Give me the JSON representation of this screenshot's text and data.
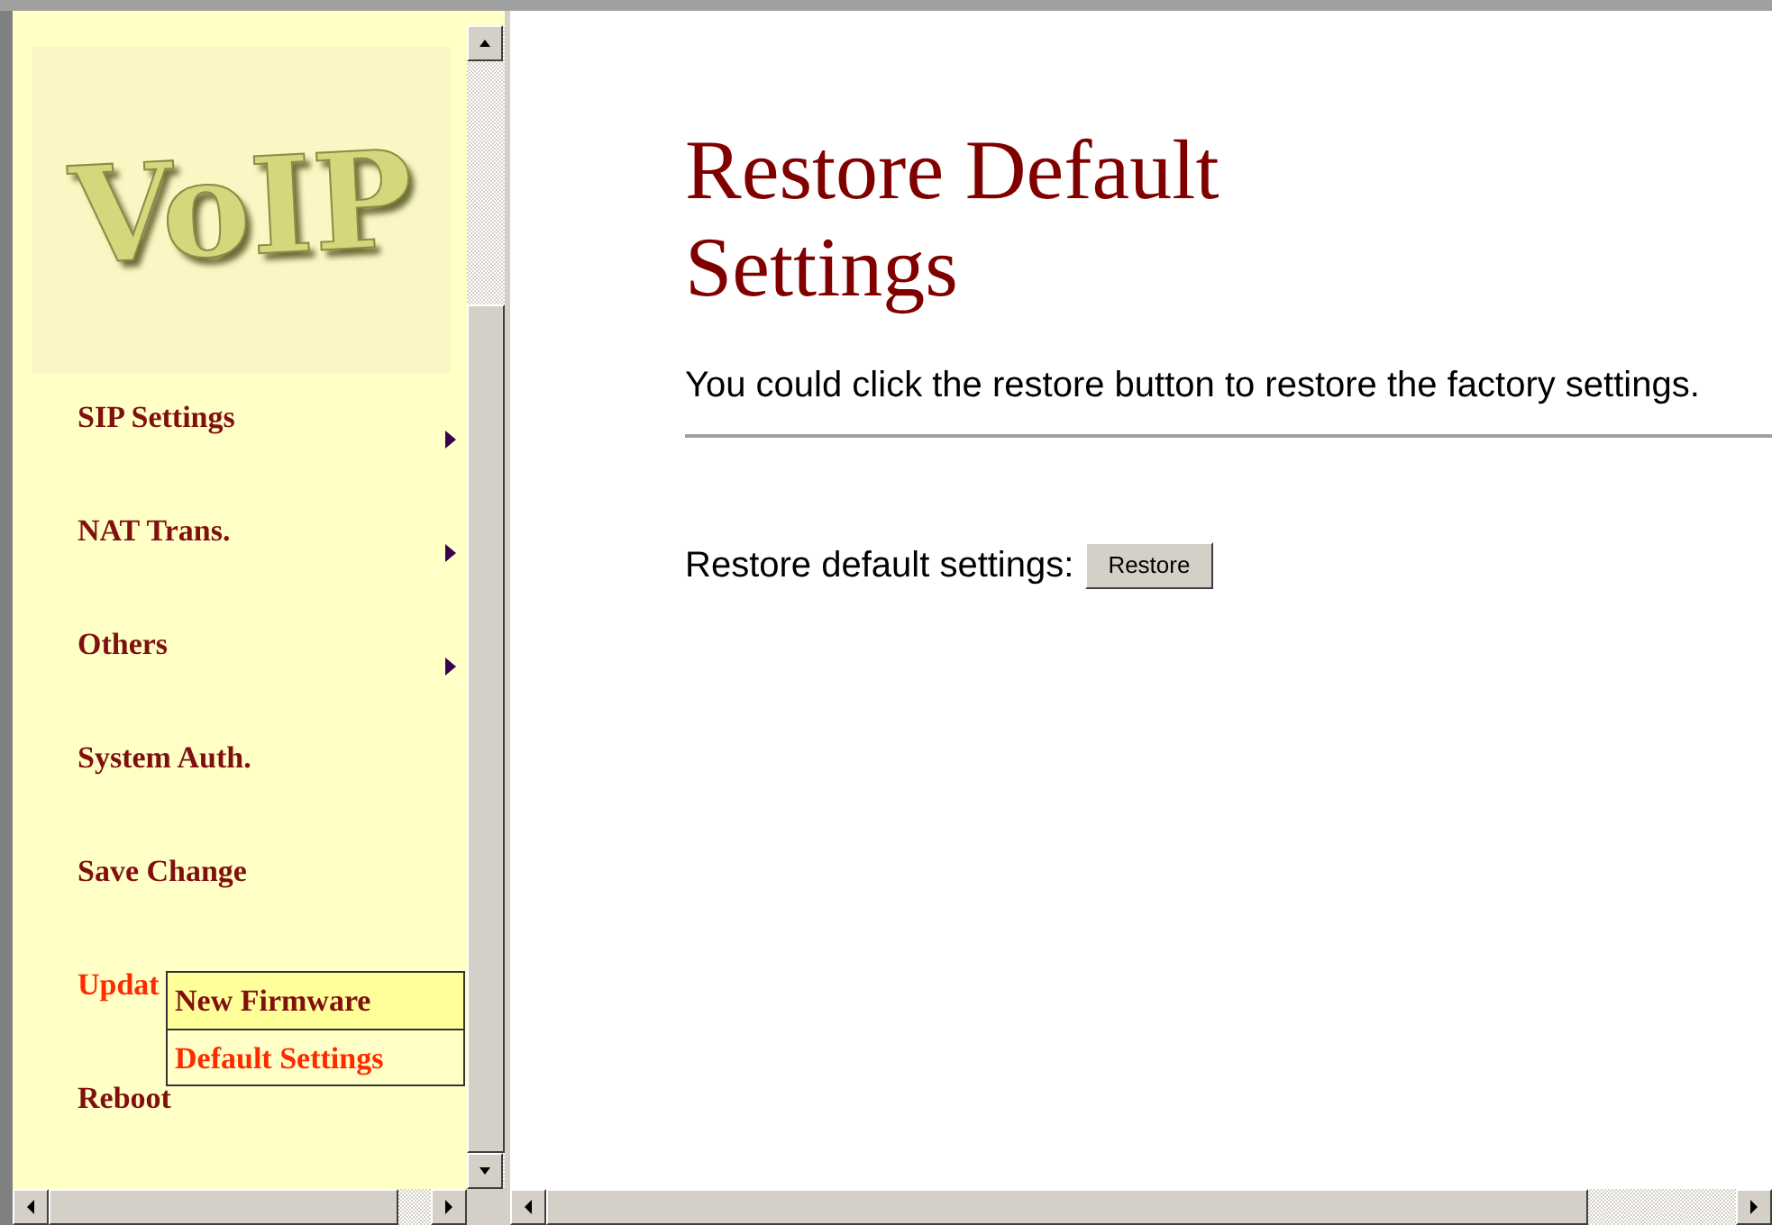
{
  "logo": "VoIP",
  "menu": [
    {
      "label": "SIP Settings",
      "selected": false,
      "has_submenu": true
    },
    {
      "label": "NAT Trans.",
      "selected": false,
      "has_submenu": true
    },
    {
      "label": "Others",
      "selected": false,
      "has_submenu": true
    },
    {
      "label": "System Auth.",
      "selected": false,
      "has_submenu": false
    },
    {
      "label": "Save Change",
      "selected": false,
      "has_submenu": false
    },
    {
      "label": "Updat",
      "selected": true,
      "has_submenu": false
    },
    {
      "label": "Reboot",
      "selected": false,
      "has_submenu": false
    }
  ],
  "submenu": [
    {
      "label": "New Firmware",
      "highlighted": true,
      "selected": false
    },
    {
      "label": "Default Settings",
      "highlighted": false,
      "selected": true
    }
  ],
  "title": "Restore Default Settings",
  "description": "You could click the restore button to restore the factory settings.",
  "restore_label": "Restore default settings:",
  "restore_button": "Restore"
}
